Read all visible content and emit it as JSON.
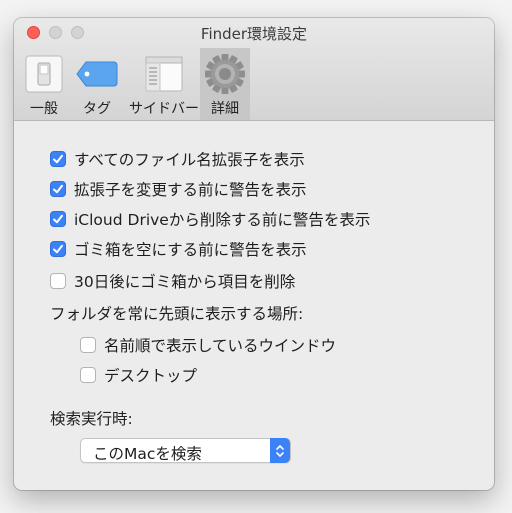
{
  "window": {
    "title": "Finder環境設定"
  },
  "toolbar": {
    "tabs": [
      {
        "label": "一般",
        "icon": "light-switch-icon"
      },
      {
        "label": "タグ",
        "icon": "tag-icon"
      },
      {
        "label": "サイドバー",
        "icon": "sidebar-icon"
      },
      {
        "label": "詳細",
        "icon": "gear-icon",
        "selected": true
      }
    ]
  },
  "options": [
    {
      "label": "すべてのファイル名拡張子を表示",
      "checked": true
    },
    {
      "label": "拡張子を変更する前に警告を表示",
      "checked": true
    },
    {
      "label": "iCloud Driveから削除する前に警告を表示",
      "checked": true
    },
    {
      "label": "ゴミ箱を空にする前に警告を表示",
      "checked": true
    },
    {
      "label": "30日後にゴミ箱から項目を削除",
      "checked": false
    }
  ],
  "folders_first": {
    "heading": "フォルダを常に先頭に表示する場所:",
    "items": [
      {
        "label": "名前順で表示しているウインドウ",
        "checked": false
      },
      {
        "label": "デスクトップ",
        "checked": false
      }
    ]
  },
  "search": {
    "heading": "検索実行時:",
    "selected": "このMacを検索"
  },
  "colors": {
    "accent": "#3b82f7",
    "close": "#ff5f57"
  }
}
